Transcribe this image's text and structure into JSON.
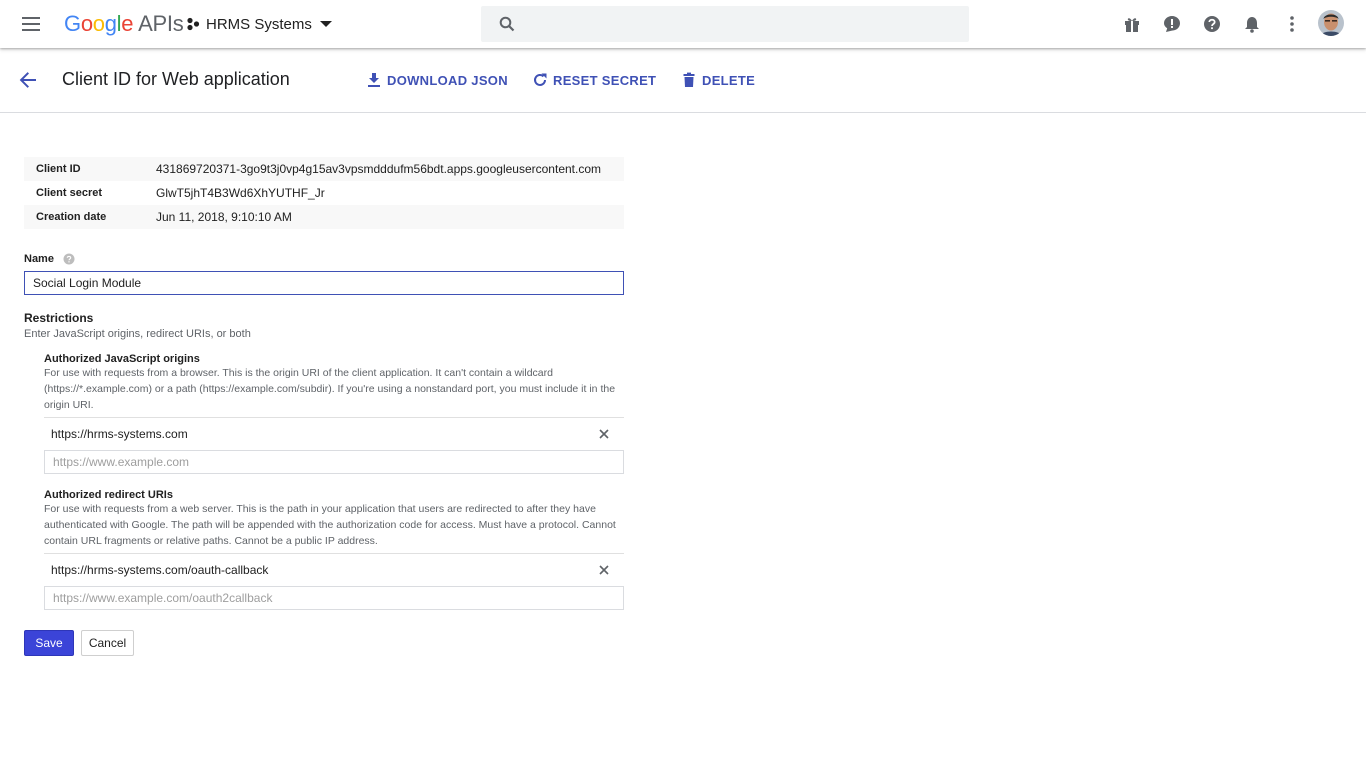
{
  "appbar": {
    "logo_google": [
      "G",
      "o",
      "o",
      "g",
      "l",
      "e"
    ],
    "logo_apis": "APIs",
    "project_name": "HRMS Systems",
    "search_placeholder": ""
  },
  "header": {
    "title": "Client ID for Web application",
    "actions": {
      "download": "DOWNLOAD JSON",
      "reset": "RESET SECRET",
      "delete": "DELETE"
    }
  },
  "info": {
    "client_id_label": "Client ID",
    "client_id": "431869720371-3go9t3j0vp4g15av3vpsmdddufm56bdt.apps.googleusercontent.com",
    "client_secret_label": "Client secret",
    "client_secret": "GlwT5jhT4B3Wd6XhYUTHF_Jr",
    "creation_date_label": "Creation date",
    "creation_date": "Jun 11, 2018, 9:10:10 AM"
  },
  "name_field": {
    "label": "Name",
    "value": "Social Login Module"
  },
  "restrictions": {
    "title": "Restrictions",
    "subtitle": "Enter JavaScript origins, redirect URIs, or both",
    "js_origins": {
      "title": "Authorized JavaScript origins",
      "description": "For use with requests from a browser. This is the origin URI of the client application. It can't contain a wildcard (https://*.example.com) or a path (https://example.com/subdir). If you're using a nonstandard port, you must include it in the origin URI.",
      "entry": "https://hrms-systems.com",
      "placeholder": "https://www.example.com"
    },
    "redirect_uris": {
      "title": "Authorized redirect URIs",
      "description": "For use with requests from a web server. This is the path in your application that users are redirected to after they have authenticated with Google. The path will be appended with the authorization code for access. Must have a protocol. Cannot contain URL fragments or relative paths. Cannot be a public IP address.",
      "entry": "https://hrms-systems.com/oauth-callback",
      "placeholder": "https://www.example.com/oauth2callback"
    }
  },
  "buttons": {
    "save": "Save",
    "cancel": "Cancel"
  },
  "colors": {
    "accent": "#3f51b5",
    "save_button": "#3b44d8"
  },
  "icons": [
    "menu-icon",
    "project-dots-icon",
    "dropdown-arrow-icon",
    "search-icon",
    "gift-icon",
    "feedback-icon",
    "help-icon",
    "notifications-icon",
    "more-vert-icon",
    "back-arrow-icon",
    "download-icon",
    "refresh-icon",
    "trash-icon",
    "close-icon"
  ]
}
